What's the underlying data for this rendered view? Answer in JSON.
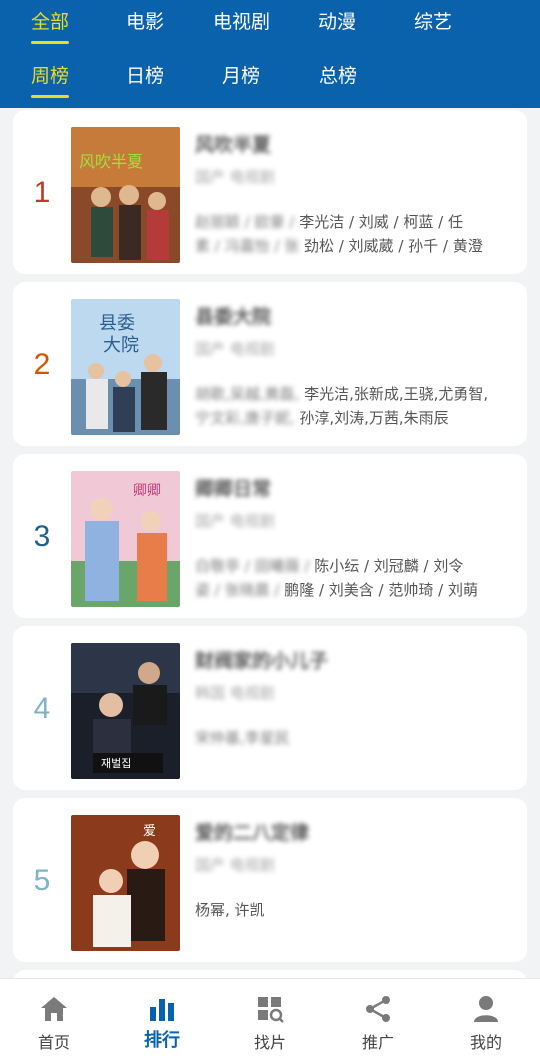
{
  "top_tabs": [
    {
      "label": "全部",
      "active": true
    },
    {
      "label": "电影",
      "active": false
    },
    {
      "label": "电视剧",
      "active": false
    },
    {
      "label": "动漫",
      "active": false
    },
    {
      "label": "综艺",
      "active": false
    }
  ],
  "period_tabs": [
    {
      "label": "周榜",
      "active": true
    },
    {
      "label": "日榜",
      "active": false
    },
    {
      "label": "月榜",
      "active": false
    },
    {
      "label": "总榜",
      "active": false
    }
  ],
  "items": [
    {
      "rank": "1",
      "rank_color": "#c0392b",
      "title": "风吹半夏",
      "meta": "国产 电视剧",
      "cast_blurred": "赵丽颖 / 欧豪 /",
      "cast": "李光洁 / 刘威 / 柯蓝 / 任",
      "cast_line2_blurred": "素 / 冯嘉怡 / 张",
      "cast_line2": "劲松 / 刘威葳 / 孙千 / 黄澄"
    },
    {
      "rank": "2",
      "rank_color": "#d35400",
      "title": "县委大院",
      "meta": "国产 电视剧",
      "cast_blurred": "胡歌,吴越,黄磊,",
      "cast": "李光洁,张新成,王骁,尤勇智,",
      "cast_line2_blurred": "宁文彩,唐子妮,",
      "cast_line2": "孙淳,刘涛,万茜,朱雨辰"
    },
    {
      "rank": "3",
      "rank_color": "#1f5f8b",
      "title": "卿卿日常",
      "meta": "国产 电视剧",
      "cast_blurred": "白敬亭 / 田曦薇 /",
      "cast": "陈小纭 / 刘冠麟 / 刘令",
      "cast_line2_blurred": "姿 / 张晓晨 / ",
      "cast_line2": "鹏隆 / 刘美含 / 范帅琦 / 刘萌"
    },
    {
      "rank": "4",
      "rank_color": "#7fb3c6",
      "title": "财阀家的小儿子",
      "meta": "韩国 电视剧",
      "cast_blurred": "宋仲基,李星民",
      "cast": "",
      "cast_line2_blurred": "",
      "cast_line2": ""
    },
    {
      "rank": "5",
      "rank_color": "#7fb3c6",
      "title": "爱的二八定律",
      "meta": "国产 电视剧",
      "cast_blurred": "",
      "cast": "杨幂, 许凯",
      "cast_line2_blurred": "",
      "cast_line2": ""
    }
  ],
  "bottom_nav": [
    {
      "label": "首页",
      "icon": "home-icon",
      "active": false
    },
    {
      "label": "排行",
      "icon": "ranking-icon",
      "active": true
    },
    {
      "label": "找片",
      "icon": "find-icon",
      "active": false
    },
    {
      "label": "推广",
      "icon": "share-icon",
      "active": false
    },
    {
      "label": "我的",
      "icon": "profile-icon",
      "active": false
    }
  ],
  "colors": {
    "header_bg": "#0a62ac",
    "active_tab": "#e8dc24",
    "nav_active": "#0a62ac"
  }
}
